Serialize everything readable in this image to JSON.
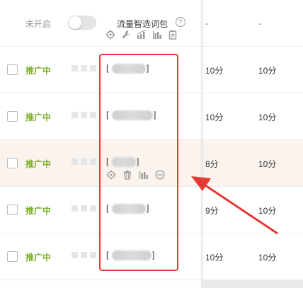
{
  "header": {
    "status_label": "未开启",
    "column_label": "流量智选词包",
    "help_glyph": "?",
    "col3_value": "-",
    "col4_value": "-"
  },
  "rows": [
    {
      "status": "推广中",
      "kw_open": "[",
      "kw_close": "]",
      "score1": "10分",
      "score2": "10分"
    },
    {
      "status": "推广中",
      "kw_open": "[",
      "kw_close": "]",
      "score1": "10分",
      "score2": "10分"
    },
    {
      "status": "推广中",
      "kw_open": "[",
      "kw_close": "]",
      "score1": "8分",
      "score2": "10分",
      "hovered": true
    },
    {
      "status": "推广中",
      "kw_open": "[",
      "kw_close": "]",
      "score1": "9分",
      "score2": "10分"
    },
    {
      "status": "推广中",
      "kw_open": "[",
      "kw_close": "]",
      "score1": "10分",
      "score2": "10分"
    }
  ],
  "colors": {
    "status_active": "#7ab024",
    "annotation": "#e53935",
    "highlight_row": "#fbf3ed"
  },
  "icons": {
    "header": [
      "gear-icon",
      "wrench-icon",
      "trend-chart-icon",
      "bar-chart-icon",
      "clipboard-icon"
    ],
    "row_hover": [
      "target-icon",
      "trash-icon",
      "bar-chart-icon",
      "more-circle-icon"
    ]
  }
}
